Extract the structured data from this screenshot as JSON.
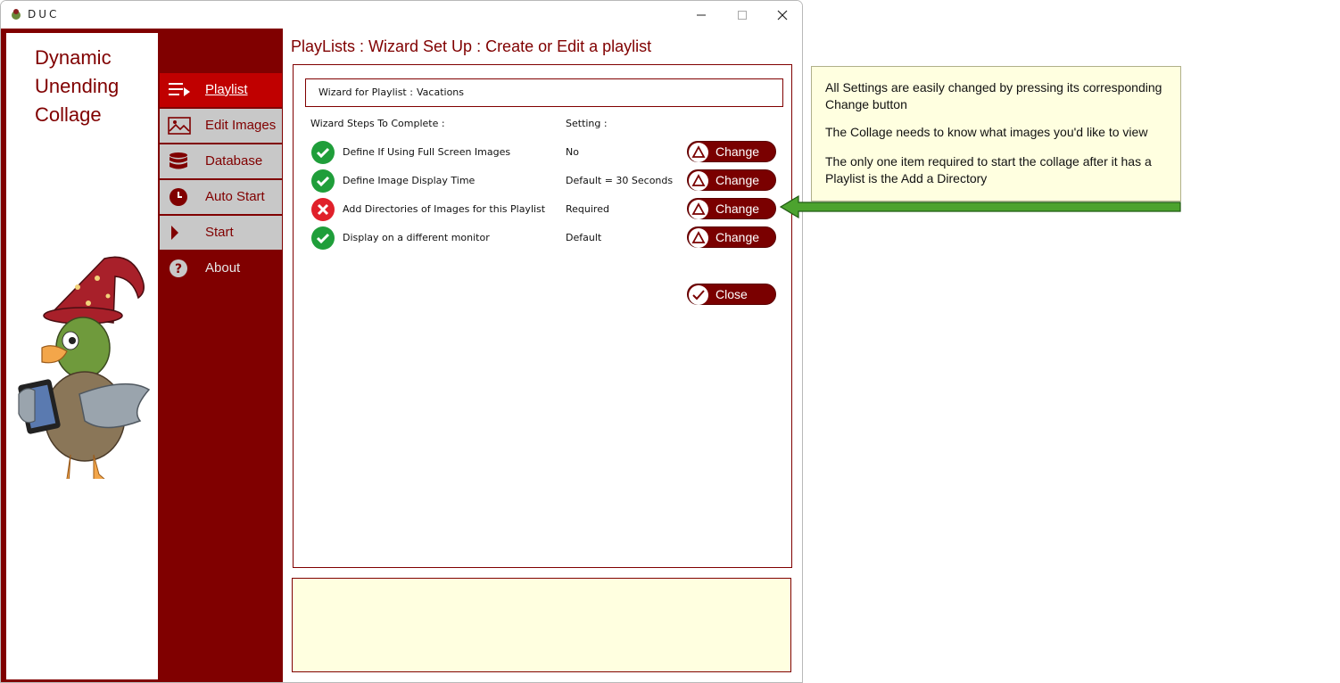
{
  "window": {
    "title": "DUC"
  },
  "logo": {
    "lines": [
      "Dynamic",
      "Unending",
      "Collage"
    ]
  },
  "nav": {
    "items": [
      {
        "label": "Playlist",
        "icon": "playlist-icon",
        "state": "active"
      },
      {
        "label": "Edit Images",
        "icon": "image-icon",
        "state": "grey"
      },
      {
        "label": "Database",
        "icon": "database-icon",
        "state": "grey"
      },
      {
        "label": "Auto Start",
        "icon": "clock-icon",
        "state": "grey"
      },
      {
        "label": "Start",
        "icon": "play-icon",
        "state": "grey"
      },
      {
        "label": "About",
        "icon": "help-icon",
        "state": "plain"
      }
    ]
  },
  "page": {
    "title": "PlayLists : Wizard Set Up : Create or Edit a playlist",
    "playlist_label": "Wizard for Playlist :",
    "playlist_value": "Vacations",
    "steps_header": "Wizard Steps To Complete :",
    "setting_header": "Setting :",
    "steps": [
      {
        "status": "complete",
        "label": "Define If Using Full Screen Images",
        "setting": "No",
        "button": "Change"
      },
      {
        "status": "complete",
        "label": "Define Image Display Time",
        "setting": "Default = 30 Seconds",
        "button": "Change"
      },
      {
        "status": "required",
        "label": "Add Directories of Images for this Playlist",
        "setting": "Required",
        "button": "Change"
      },
      {
        "status": "complete",
        "label": "Display on a different monitor",
        "setting": "Default",
        "button": "Change"
      }
    ],
    "close_button": "Close"
  },
  "callout": {
    "lines": [
      "All Settings are easily changed by pressing its corresponding Change button",
      "The Collage needs to know what images you'd like to view",
      "The only one item required to start the collage after it has a Playlist is the Add a Directory"
    ]
  },
  "colors": {
    "brand": "#800000",
    "active_nav": "#c00000",
    "ok": "#1f9e3a",
    "error": "#e0202a",
    "callout_bg": "#ffffe0",
    "arrow": "#4ca32e"
  }
}
